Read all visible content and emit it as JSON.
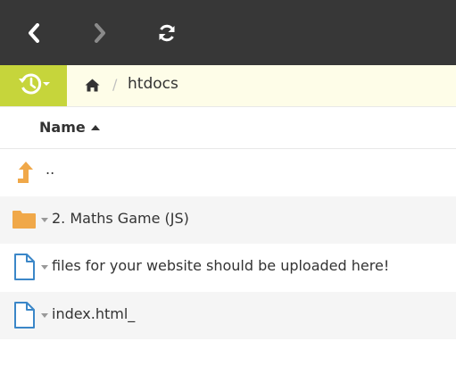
{
  "toolbar": {
    "back_icon": "chevron-left-icon",
    "forward_icon": "chevron-right-icon",
    "refresh_icon": "refresh-icon"
  },
  "pathbar": {
    "history_icon": "history-icon",
    "home_icon": "home-icon",
    "separator": "/",
    "crumbs": [
      "htdocs"
    ]
  },
  "columns": {
    "name_label": "Name",
    "sort": "ascending"
  },
  "rows": [
    {
      "label": "..",
      "icon": "level-up-icon"
    },
    {
      "label": "2. Maths Game (JS)",
      "icon": "folder-icon"
    },
    {
      "label": "files for your website should be uploaded here!",
      "icon": "file-icon"
    },
    {
      "label": "index.html_",
      "icon": "file-icon"
    }
  ],
  "colors": {
    "toolbar_bg": "#373737",
    "history_bg": "#c6d53b",
    "pathbar_bg": "#fefde8",
    "folder": "#f0a849",
    "file_outline": "#3b87c8"
  }
}
